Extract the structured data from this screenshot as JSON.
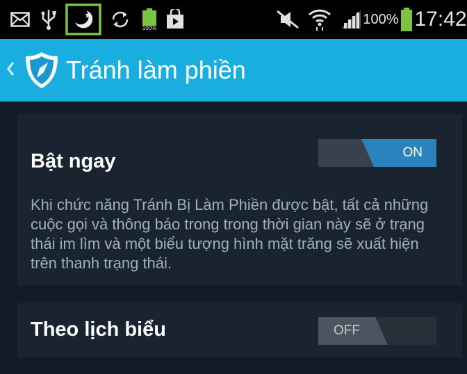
{
  "status_bar": {
    "battery_percent_label": "100%",
    "battery_small_label": "100%",
    "time": "17:42",
    "highlight_color": "#7dc243",
    "icons": [
      "mail-icon",
      "usb-icon",
      "do-not-disturb-moon-icon",
      "sync-icon",
      "battery-icon",
      "play-store-icon",
      "mute-icon",
      "wifi-icon",
      "signal-icon",
      "battery-icon"
    ]
  },
  "action_bar": {
    "title": "Tránh làm phiền",
    "color": "#1aaee0"
  },
  "settings": {
    "now": {
      "title": "Bật ngay",
      "toggle_label": "ON",
      "toggle_state": "on",
      "description": "Khi chức năng Tránh Bị Làm Phiền được bật, tất cả những cuộc gọi và thông báo trong trong thời gian này sẽ ở trạng thái im lìm và một biểu tượng hình mặt trăng sẽ xuất hiện trên thanh trạng thái."
    },
    "schedule": {
      "title": "Theo lịch biểu",
      "toggle_label": "OFF",
      "toggle_state": "off"
    }
  }
}
